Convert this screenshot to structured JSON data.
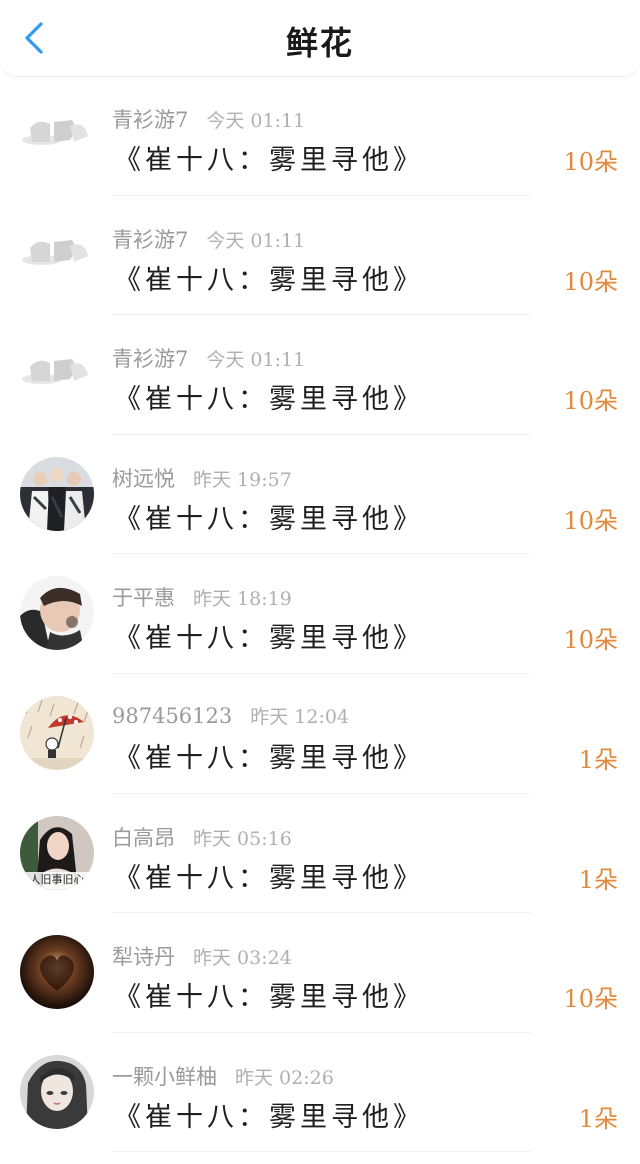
{
  "header": {
    "title": "鲜花",
    "back_icon": "chevron-left-icon"
  },
  "colors": {
    "accent_blue": "#2f9bf0",
    "flower_orange": "#e08a3c",
    "meta_gray": "#9a9a9a"
  },
  "items": [
    {
      "user": "青衫游7",
      "time": "今天 01:11",
      "book": "《崔十八：雾里寻他》",
      "flowers": "10朵",
      "avatar": "avatar-logo-placeholder"
    },
    {
      "user": "青衫游7",
      "time": "今天 01:11",
      "book": "《崔十八：雾里寻他》",
      "flowers": "10朵",
      "avatar": "avatar-logo-placeholder"
    },
    {
      "user": "青衫游7",
      "time": "今天 01:11",
      "book": "《崔十八：雾里寻他》",
      "flowers": "10朵",
      "avatar": "avatar-logo-placeholder"
    },
    {
      "user": "树远悦",
      "time": "昨天 19:57",
      "book": "《崔十八：雾里寻他》",
      "flowers": "10朵",
      "avatar": "avatar-group-photo"
    },
    {
      "user": "于平惠",
      "time": "昨天 18:19",
      "book": "《崔十八：雾里寻他》",
      "flowers": "10朵",
      "avatar": "avatar-portrait"
    },
    {
      "user": "987456123",
      "time": "昨天 12:04",
      "book": "《崔十八：雾里寻他》",
      "flowers": "1朵",
      "avatar": "avatar-umbrella-drawing"
    },
    {
      "user": "白高昂",
      "time": "昨天 05:16",
      "book": "《崔十八：雾里寻他》",
      "flowers": "1朵",
      "avatar": "avatar-girl-photo",
      "avatar_caption": "人旧事旧心"
    },
    {
      "user": "犁诗丹",
      "time": "昨天 03:24",
      "book": "《崔十八：雾里寻他》",
      "flowers": "10朵",
      "avatar": "avatar-dark-heart"
    },
    {
      "user": "一颗小鲜柚",
      "time": "昨天 02:26",
      "book": "《崔十八：雾里寻他》",
      "flowers": "1朵",
      "avatar": "avatar-anime-girl"
    }
  ]
}
